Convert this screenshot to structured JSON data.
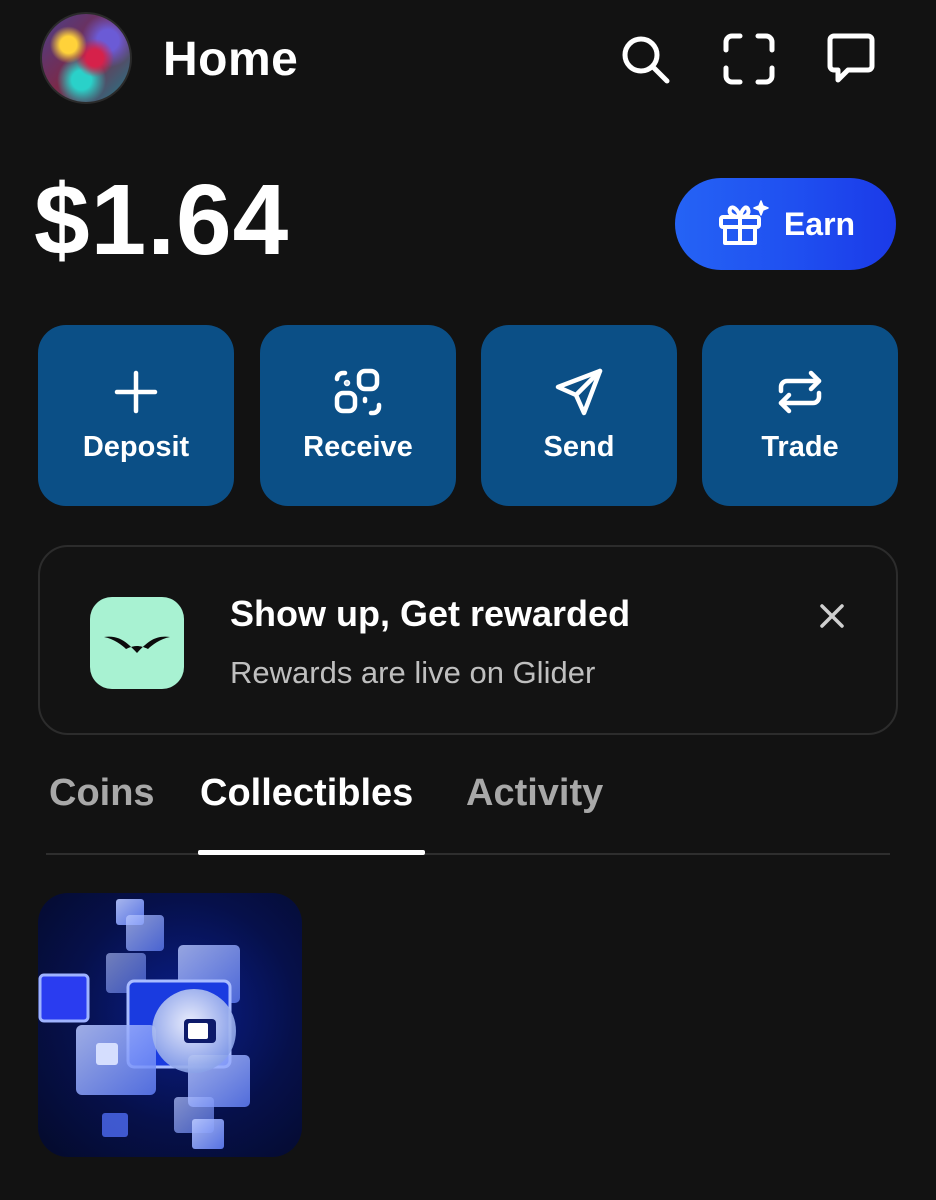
{
  "header": {
    "title": "Home",
    "icons": [
      "search-icon",
      "scan-icon",
      "chat-icon"
    ]
  },
  "balance": {
    "amount": "$1.64",
    "earn_label": "Earn"
  },
  "actions": [
    {
      "label": "Deposit",
      "icon": "plus-icon"
    },
    {
      "label": "Receive",
      "icon": "qr-icon"
    },
    {
      "label": "Send",
      "icon": "send-icon"
    },
    {
      "label": "Trade",
      "icon": "swap-icon"
    }
  ],
  "promo": {
    "title": "Show up, Get rewarded",
    "subtitle": "Rewards are live on Glider",
    "logo_color": "#a8f2d2"
  },
  "tabs": [
    {
      "label": "Coins",
      "active": false
    },
    {
      "label": "Collectibles",
      "active": true
    },
    {
      "label": "Activity",
      "active": false
    }
  ],
  "colors": {
    "background": "#121212",
    "action_button": "#0b4f86",
    "earn_button": "#2563f5",
    "muted_text": "#bfbfbf"
  }
}
